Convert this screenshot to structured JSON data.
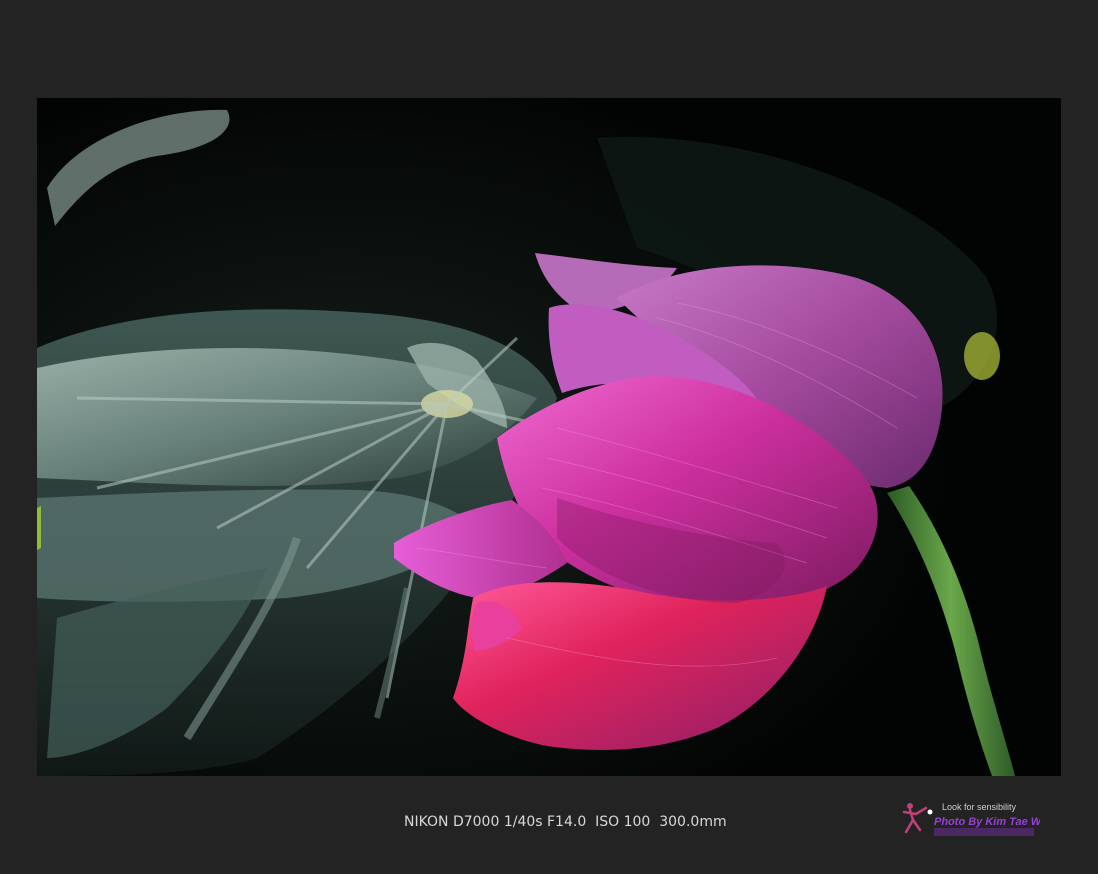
{
  "caption": {
    "exif": "NIKON D7000 1/40s F14.0  ISO 100  300.0mm"
  },
  "watermark": {
    "tagline": "Look for sensibility",
    "credit": "Photo By Kim Tae Won"
  },
  "colors": {
    "background": "#232323",
    "petal_pink": "#d63fa8",
    "petal_magenta": "#a0288a",
    "stem_green": "#4f8a3a",
    "leaf_gray": "#8aa29a",
    "logo_purple": "#9a3fd6"
  }
}
